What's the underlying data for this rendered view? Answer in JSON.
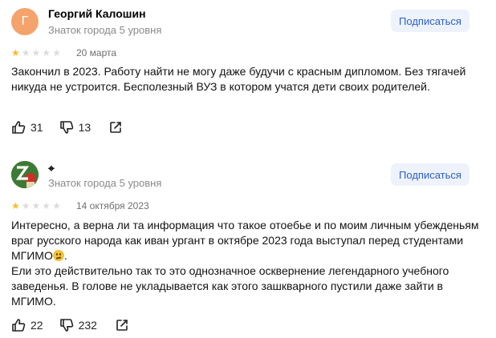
{
  "reviews": [
    {
      "avatar_letter": "Г",
      "avatar_color": "#f5a36c",
      "author": "Георгий Калошин",
      "level": "Знаток города 5 уровня",
      "subscribe_label": "Подписаться",
      "rating": 1,
      "date": "20 марта",
      "text_lines": [
        "Закончил в 2023. Работу найти не могу даже будучи с красным дипломом. Без тягачей никуда не устроится. Бесполезный ВУЗ в котором учатся дети своих родителей."
      ],
      "likes": "31",
      "dislikes": "13"
    },
    {
      "avatar_icon": "z-letter-avatar-icon",
      "author": "⌖",
      "level": "Знаток города 5 уровня",
      "subscribe_label": "Подписаться",
      "rating": 1,
      "date": "14 октября 2023",
      "text_part1": "Интересно, а верна ли та информация что такое отоебье и по моим личным убежденьям враг русского народа как иван ургант в октябре 2023 года выступал перед студентами МГИМО",
      "emoji": "thinking-face-icon",
      "text_part1_end": ".",
      "text_part2": "Ели это действительно так то это однозначное осквернение легендарного учебного заведенья. В голове не укладывается как этого зашкварного пустили даже зайти в МГИМО.",
      "likes": "22",
      "dislikes": "232"
    }
  ]
}
